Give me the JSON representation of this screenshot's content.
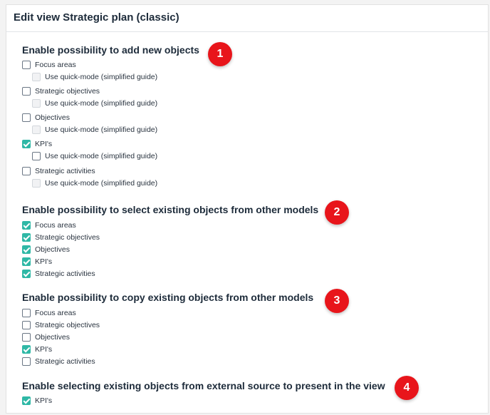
{
  "panel": {
    "title": "Edit view Strategic plan (classic)"
  },
  "sections": [
    {
      "title": "Enable possibility to add new objects",
      "badge": "1",
      "items": [
        {
          "label": "Focus areas",
          "checked": false,
          "sub_label": "Use quick-mode (simplified guide)",
          "sub_checked": false,
          "sub_enabled": false
        },
        {
          "label": "Strategic objectives",
          "checked": false,
          "sub_label": "Use quick-mode (simplified guide)",
          "sub_checked": false,
          "sub_enabled": false
        },
        {
          "label": "Objectives",
          "checked": false,
          "sub_label": "Use quick-mode (simplified guide)",
          "sub_checked": false,
          "sub_enabled": false
        },
        {
          "label": "KPI's",
          "checked": true,
          "sub_label": "Use quick-mode (simplified guide)",
          "sub_checked": false,
          "sub_enabled": true
        },
        {
          "label": "Strategic activities",
          "checked": false,
          "sub_label": "Use quick-mode (simplified guide)",
          "sub_checked": false,
          "sub_enabled": false
        }
      ]
    },
    {
      "title": "Enable possibility to select existing objects from other models",
      "badge": "2",
      "items": [
        {
          "label": "Focus areas",
          "checked": true
        },
        {
          "label": "Strategic objectives",
          "checked": true
        },
        {
          "label": "Objectives",
          "checked": true
        },
        {
          "label": "KPI's",
          "checked": true
        },
        {
          "label": "Strategic activities",
          "checked": true
        }
      ]
    },
    {
      "title": "Enable possibility to copy existing objects from other models",
      "badge": "3",
      "items": [
        {
          "label": "Focus areas",
          "checked": false
        },
        {
          "label": "Strategic objectives",
          "checked": false
        },
        {
          "label": "Objectives",
          "checked": false
        },
        {
          "label": "KPI's",
          "checked": true
        },
        {
          "label": "Strategic activities",
          "checked": false
        }
      ]
    },
    {
      "title": "Enable selecting existing objects from external source to present in the view",
      "badge": "4",
      "items": [
        {
          "label": "KPI's",
          "checked": true
        }
      ]
    }
  ],
  "colors": {
    "accent": "#2fb8a6",
    "badge": "#e8151b",
    "title": "#1d2b3a"
  }
}
